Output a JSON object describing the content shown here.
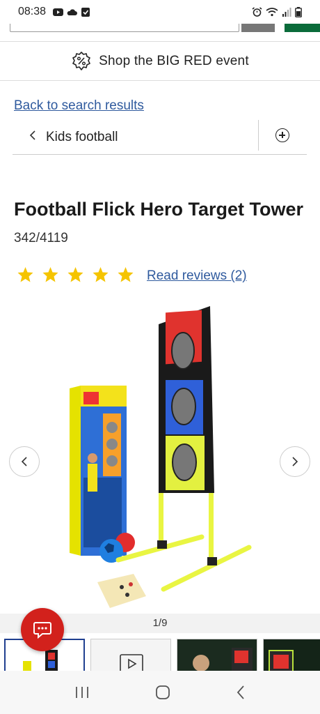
{
  "status_bar": {
    "time": "08:38"
  },
  "promo": {
    "text": "Shop the BIG RED event",
    "icon": "percent-badge-icon"
  },
  "back_link": "Back to search results",
  "breadcrumb": {
    "label": "Kids football"
  },
  "product": {
    "title": "Football Flick Hero Target Tower",
    "sku": "342/4119",
    "rating": 5,
    "rating_max": 5,
    "reviews_link": "Read reviews (2)"
  },
  "gallery": {
    "counter": "1/9"
  },
  "colors": {
    "link": "#2f5a9e",
    "star": "#f5c400",
    "accent_red": "#d2211c",
    "brand_green": "#0a6b3a"
  }
}
